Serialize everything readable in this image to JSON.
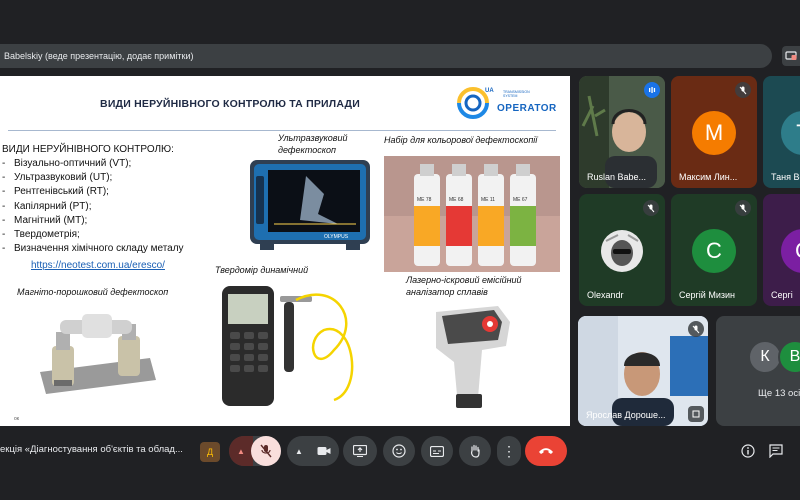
{
  "presenter_bar": {
    "text": "Babelskiy (веде презентацію, додає примітки)"
  },
  "slide": {
    "title": "ВИДИ НЕРУЙНІВНОГО КОНТРОЛЮ ТА ПРИЛАДИ",
    "logo": {
      "ua": "UA",
      "sub": "TRANSMISSION SYSTEM",
      "operator": "OPERATOR"
    },
    "list_title": "ВИДИ НЕРУЙНІВНОГО КОНТРОЛЮ:",
    "items": [
      "Візуально-оптичний (VT);",
      "Ультразвуковий (UT);",
      "Рентгенівський (RT);",
      "Капілярний (PT);",
      "Магнітний (MT);",
      "Твердометрія;",
      "Визначення хімічного складу металу"
    ],
    "link": "https://neotest.com.ua/eresco/",
    "captions": {
      "ultrasonic": "Ультразвуковий дефектоскоп",
      "color_kit": "Набір для кольорової дефектоскопії",
      "hardness": "Твердомір динамічний",
      "laser": "Лазерно-іскровий емісійний аналізатор сплавів",
      "magnetic": "Магніто-порошковий дефектоскоп"
    },
    "device_brand": "OLYMPUS",
    "can_labels": [
      "МЕ 78",
      "МЕ 68",
      "МЕ 11",
      "МЕ 67"
    ],
    "corner_mark": "ок"
  },
  "participants": [
    {
      "name": "Ruslan Babe...",
      "kind": "video"
    },
    {
      "name": "Максим Лин...",
      "initial": "М",
      "color": "#f57c00",
      "muted": true
    },
    {
      "name": "Таня Во",
      "initial": "Т",
      "color": "#2e7d8a",
      "muted": false
    },
    {
      "name": "Olexandr",
      "kind": "photo",
      "muted": true
    },
    {
      "name": "Сергій Мизин",
      "initial": "С",
      "color": "#1e8e3e",
      "muted": true
    },
    {
      "name": "Сергі",
      "initial": "С",
      "color": "#7b1fa2",
      "muted": false
    },
    {
      "name": "Ярослав Дороше...",
      "kind": "video",
      "muted": true
    }
  ],
  "overflow": {
    "initials": [
      "К",
      "В"
    ],
    "colors": [
      "#5f6368",
      "#1e8e3e"
    ],
    "label": "Ще 13 осі"
  },
  "bottom": {
    "meeting_title": "екція «Діагностування об'єктів та облад..."
  }
}
